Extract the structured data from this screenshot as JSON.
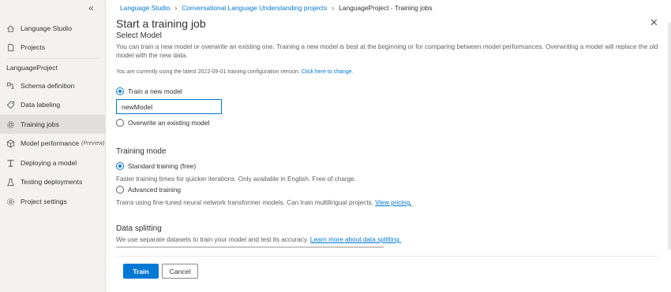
{
  "sidebar": {
    "collapse_icon": "double-chevron-left-icon",
    "top_items": [
      {
        "label": "Language Studio",
        "icon": "home-icon"
      },
      {
        "label": "Projects",
        "icon": "document-icon"
      }
    ],
    "project_name": "LanguageProject",
    "items": [
      {
        "label": "Schema definition",
        "icon": "schema-icon"
      },
      {
        "label": "Data labeling",
        "icon": "tag-icon"
      },
      {
        "label": "Training jobs",
        "icon": "gear-icon",
        "active": true
      },
      {
        "label": "Model performance",
        "preview": "(Preview)",
        "icon": "cube-icon"
      },
      {
        "label": "Deploying a model",
        "icon": "deploy-icon"
      },
      {
        "label": "Testing deployments",
        "icon": "flask-icon"
      },
      {
        "label": "Project settings",
        "icon": "settings-icon"
      }
    ]
  },
  "breadcrumb": {
    "items": [
      "Language Studio",
      "Conversational Language Understanding projects"
    ],
    "current": "LanguageProject - Training jobs"
  },
  "panel": {
    "title": "Start a training job",
    "close_icon": "close-icon",
    "select_model": {
      "heading": "Select Model",
      "description": "You can train a new model or overwrite an existing one. Training a new model is best at the beginning or for comparing between model performances. Overwriting a model will replace the old model with the new data.",
      "config_note": "You are currently using the latest 2022-09-01 training configuration version.",
      "config_link": "Click here to change.",
      "option_new": "Train a new model",
      "model_name_value": "newModel",
      "option_overwrite": "Overwrite an existing model"
    },
    "training_mode": {
      "heading": "Training mode",
      "standard_label": "Standard training (free)",
      "standard_desc": "Faster training times for quicker iterations. Only available in English. Free of charge.",
      "advanced_label": "Advanced training",
      "advanced_desc": "Trains using fine-tuned neural network transformer models. Can train multilingual projects.",
      "pricing_link": "View pricing."
    },
    "data_splitting": {
      "heading": "Data splitting",
      "desc": "We use separate datasets to train your model and test its accuracy.",
      "learn_link": "Learn more about data splitting."
    }
  },
  "footer": {
    "train_label": "Train",
    "cancel_label": "Cancel"
  },
  "colors": {
    "accent": "#0078d4",
    "sidebar_bg": "#f3f2f1",
    "active_bg": "#e1dfdd"
  }
}
